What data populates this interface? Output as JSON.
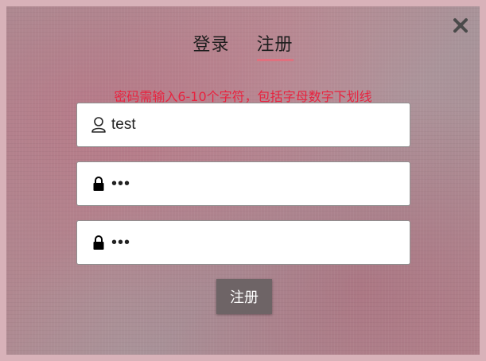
{
  "tabs": {
    "login": "登录",
    "register": "注册"
  },
  "hint": "密码需输入6-10个字符，包括字母数字下划线",
  "fields": {
    "username": {
      "value": "test",
      "icon": "user-icon"
    },
    "password": {
      "value": "abc",
      "icon": "lock-icon"
    },
    "confirm_password": {
      "value": "abc",
      "icon": "lock-icon"
    }
  },
  "submit_label": "注册",
  "close_icon": "close-icon",
  "colors": {
    "hint": "#e8233f",
    "active_tab_underline": "#e0707e",
    "button_bg": "#6e6466",
    "border": "#d8b2b9"
  }
}
